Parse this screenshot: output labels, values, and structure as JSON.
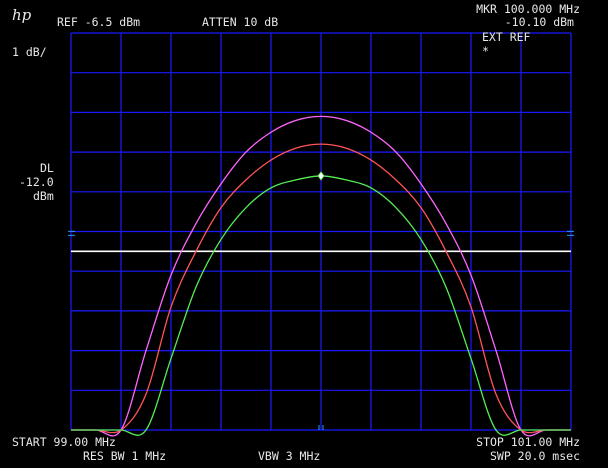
{
  "header": {
    "logo": "hp",
    "ref_level": "REF -6.5 dBm",
    "attenuation": "ATTEN 10 dB",
    "marker_freq": "MKR 100.000 MHz",
    "marker_level": "-10.10 dBm",
    "ext_ref": "EXT REF",
    "star": "*"
  },
  "left_panel": {
    "scale": "1 dB/",
    "dl_label": "DL",
    "dl_value": "-12.0",
    "dl_unit": "dBm"
  },
  "footer": {
    "start": "START 99.00 MHz",
    "stop": "STOP 101.00 MHz",
    "res_bw": "RES BW 1 MHz",
    "vbw": "VBW 3 MHz",
    "sweep": "SWP 20.0 msec"
  },
  "colors": {
    "grid": "#1a1aff",
    "trace_magenta": "#ff66ff",
    "trace_red": "#ff5555",
    "trace_green": "#55ee55",
    "display_line": "#ffffff"
  },
  "chart_data": {
    "type": "line",
    "x_unit": "MHz",
    "y_unit": "dBm",
    "xlim": [
      99.0,
      101.0
    ],
    "ylim": [
      -16.5,
      -6.5
    ],
    "display_line": -12.0,
    "marker": {
      "x": 100.0,
      "y": -10.1
    },
    "series": [
      {
        "color": "magenta",
        "x": [
          99.0,
          99.1,
          99.2,
          99.3,
          99.4,
          99.5,
          99.6,
          99.7,
          99.8,
          99.9,
          100.0,
          100.1,
          100.2,
          100.3,
          100.4,
          100.5,
          100.6,
          100.7,
          100.8,
          100.9,
          101.0
        ],
        "y": [
          -16.5,
          -16.5,
          -16.5,
          -14.5,
          -12.6,
          -11.3,
          -10.3,
          -9.5,
          -9.0,
          -8.7,
          -8.6,
          -8.7,
          -9.0,
          -9.5,
          -10.3,
          -11.3,
          -12.6,
          -14.5,
          -16.5,
          -16.5,
          -16.5
        ]
      },
      {
        "color": "red",
        "x": [
          99.0,
          99.1,
          99.2,
          99.3,
          99.4,
          99.5,
          99.6,
          99.7,
          99.8,
          99.9,
          100.0,
          100.1,
          100.2,
          100.3,
          100.4,
          100.5,
          100.6,
          100.7,
          100.8,
          100.9,
          101.0
        ],
        "y": [
          -16.5,
          -16.5,
          -16.5,
          -15.6,
          -13.4,
          -12.0,
          -10.9,
          -10.2,
          -9.7,
          -9.4,
          -9.3,
          -9.4,
          -9.7,
          -10.2,
          -10.9,
          -12.0,
          -13.4,
          -15.6,
          -16.5,
          -16.5,
          -16.5
        ]
      },
      {
        "color": "green",
        "x": [
          99.0,
          99.1,
          99.2,
          99.3,
          99.4,
          99.5,
          99.6,
          99.7,
          99.8,
          99.9,
          100.0,
          100.1,
          100.2,
          100.3,
          100.4,
          100.5,
          100.6,
          100.7,
          100.8,
          100.9,
          101.0
        ],
        "y": [
          -16.5,
          -16.5,
          -16.5,
          -16.5,
          -14.7,
          -12.9,
          -11.7,
          -10.9,
          -10.4,
          -10.2,
          -10.1,
          -10.2,
          -10.4,
          -10.9,
          -11.7,
          -12.9,
          -14.7,
          -16.5,
          -16.5,
          -16.5,
          -16.5
        ]
      }
    ]
  }
}
